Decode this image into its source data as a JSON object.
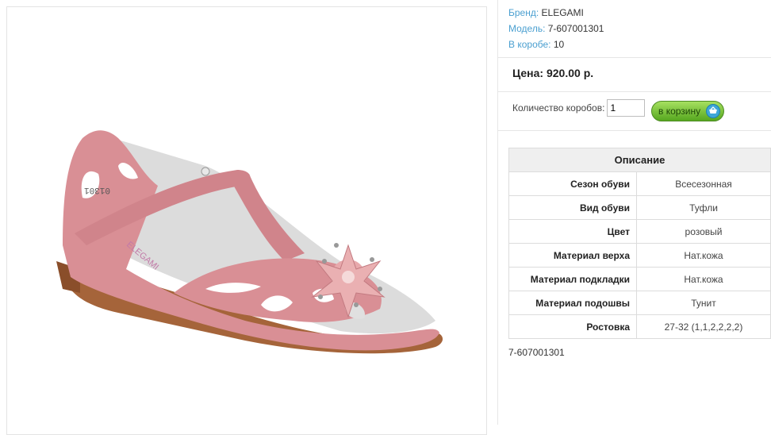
{
  "product": {
    "brand_label": "Бренд:",
    "brand": "ELEGAMI",
    "model_label": "Модель:",
    "model": "7-607001301",
    "box_label": "В коробе:",
    "box_qty": "10",
    "price_text": "Цена: 920.00 р.",
    "qty_label": "Количество коробов:",
    "qty_value": "1",
    "cart_button": "в корзину",
    "sku_footer": "7-607001301"
  },
  "description": {
    "title": "Описание",
    "rows": [
      {
        "key": "Сезон обуви",
        "value": "Всесезонная"
      },
      {
        "key": "Вид обуви",
        "value": "Туфли"
      },
      {
        "key": "Цвет",
        "value": "розовый"
      },
      {
        "key": "Материал верха",
        "value": "Нат.кожа"
      },
      {
        "key": "Материал подкладки",
        "value": "Нат.кожа"
      },
      {
        "key": "Материал подошвы",
        "value": "Тунит"
      },
      {
        "key": "Ростовка",
        "value": "27-32 (1,1,2,2,2,2)"
      }
    ]
  },
  "image": {
    "icon": "sandal-product-photo",
    "insole_print_1": "01301",
    "insole_print_2": "ELEGAMI"
  },
  "colors": {
    "link_blue": "#4a9fd0",
    "button_green": "#6cbf2e",
    "shoe_pink": "#d98f95"
  }
}
